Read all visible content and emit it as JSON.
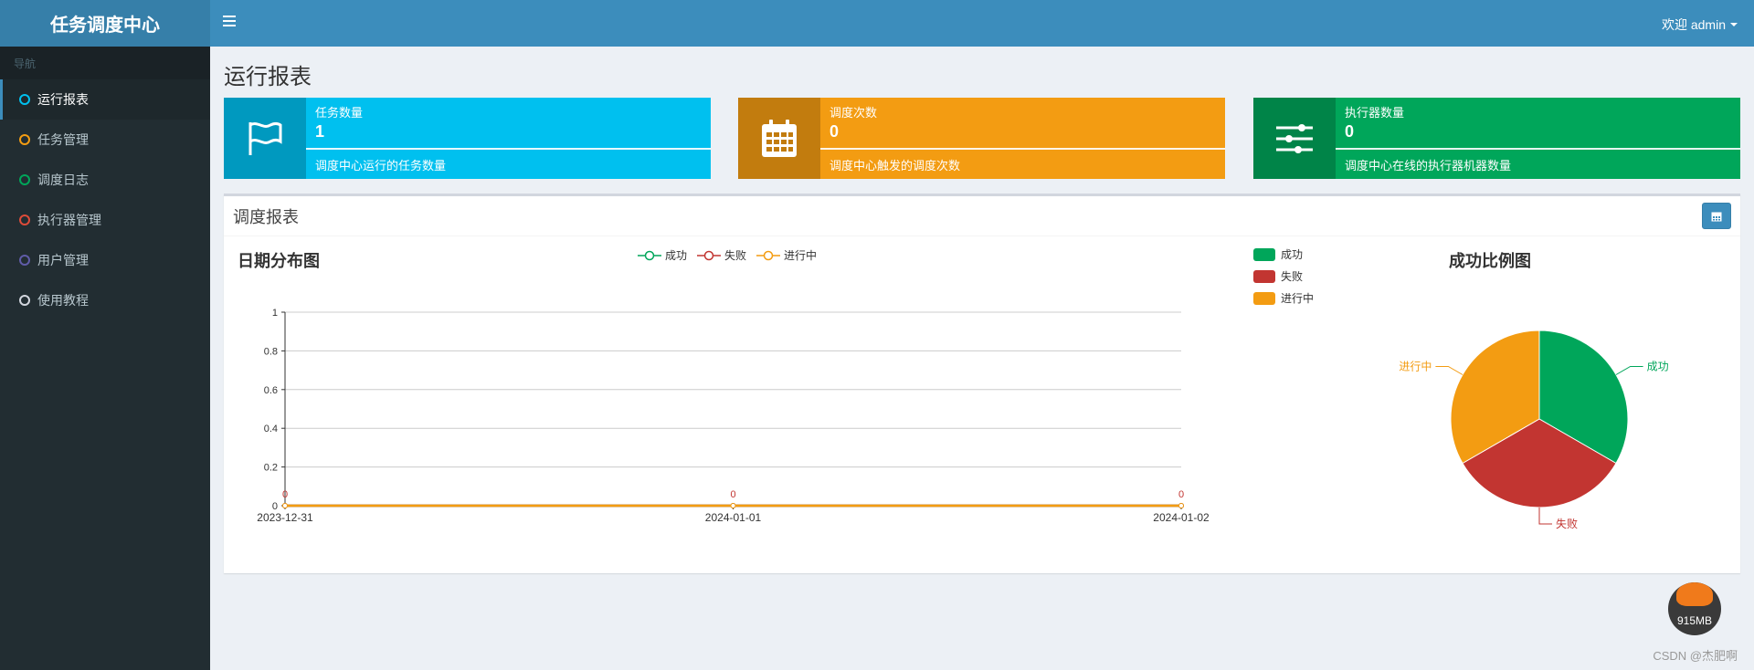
{
  "app": {
    "title": "任务调度中心"
  },
  "header": {
    "welcome": "欢迎 admin"
  },
  "sidebar": {
    "header": "导航",
    "items": [
      {
        "label": "运行报表",
        "color": "#00c0ef",
        "active": true
      },
      {
        "label": "任务管理",
        "color": "#f39c12",
        "active": false
      },
      {
        "label": "调度日志",
        "color": "#00a65a",
        "active": false
      },
      {
        "label": "执行器管理",
        "color": "#dd4b39",
        "active": false
      },
      {
        "label": "用户管理",
        "color": "#605ca8",
        "active": false
      },
      {
        "label": "使用教程",
        "color": "#d2d6de",
        "active": false
      }
    ]
  },
  "page": {
    "title": "运行报表"
  },
  "info_boxes": [
    {
      "label": "任务数量",
      "value": "1",
      "desc": "调度中心运行的任务数量",
      "color": "#00c0ef",
      "icon": "flag-icon"
    },
    {
      "label": "调度次数",
      "value": "0",
      "desc": "调度中心触发的调度次数",
      "color": "#f39c12",
      "icon": "calendar-icon"
    },
    {
      "label": "执行器数量",
      "value": "0",
      "desc": "调度中心在线的执行器机器数量",
      "color": "#00a65a",
      "icon": "sliders-icon"
    }
  ],
  "report": {
    "title": "调度报表",
    "line_title": "日期分布图",
    "pie_title": "成功比例图",
    "legend": [
      "成功",
      "失败",
      "进行中"
    ]
  },
  "colors": {
    "success": "#00a65a",
    "fail": "#c23531",
    "running": "#f39c12"
  },
  "chart_data": [
    {
      "type": "line",
      "title": "日期分布图",
      "x": [
        "2023-12-31",
        "2024-01-01",
        "2024-01-02"
      ],
      "series": [
        {
          "name": "成功",
          "values": [
            0,
            0,
            0
          ]
        },
        {
          "name": "失败",
          "values": [
            0,
            0,
            0
          ]
        },
        {
          "name": "进行中",
          "values": [
            0,
            0,
            0
          ]
        }
      ],
      "data_labels": [
        "0",
        "0",
        "0"
      ],
      "ylim": [
        0,
        1
      ],
      "yticks": [
        "0",
        "0.2",
        "0.4",
        "0.6",
        "0.8",
        "1"
      ],
      "legend_position": "top"
    },
    {
      "type": "pie",
      "title": "成功比例图",
      "labels": [
        "成功",
        "失败",
        "进行中"
      ],
      "values": [
        1,
        1,
        1
      ],
      "legend_position": "left"
    }
  ],
  "badge": {
    "text": "915MB"
  },
  "watermark": "CSDN @杰肥啊"
}
